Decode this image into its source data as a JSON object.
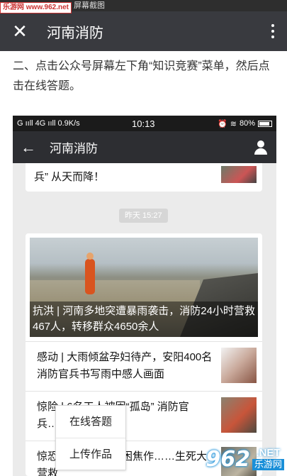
{
  "top_strip": {
    "text": "屏幕截图",
    "watermark": "乐游网 www.962.net"
  },
  "outer_header": {
    "title": "河南消防"
  },
  "instruction": "二、点击公众号屏幕左下角“知识竞赛”菜单，然后点击在线答题。",
  "phone": {
    "status": {
      "left": "G ııll 4G ııll 0.9K/s",
      "time": "10:13",
      "battery": "80%"
    },
    "header_title": "河南消防",
    "prev_card_text": "兵” 从天而降！",
    "time_badge": "昨天 15:27",
    "hero_caption": "抗洪 | 河南多地突遭暴雨袭击，消防24小时营救467人，转移群众4650余人",
    "articles": [
      {
        "text": "感动 | 大雨倾盆孕妇待产，安阳400名消防官兵书写雨中感人画面"
      },
      {
        "text": "惊险 | 6名工人被困“孤岛” 消防官兵……"
      },
      {
        "text": "惊恐……被洪水围困焦作……生死大营救"
      }
    ],
    "menu": [
      {
        "label": "在线答题"
      },
      {
        "label": "上传作品"
      }
    ]
  },
  "watermark_br": {
    "digits": "962",
    "net": ".NET",
    "cn": "乐游网"
  }
}
